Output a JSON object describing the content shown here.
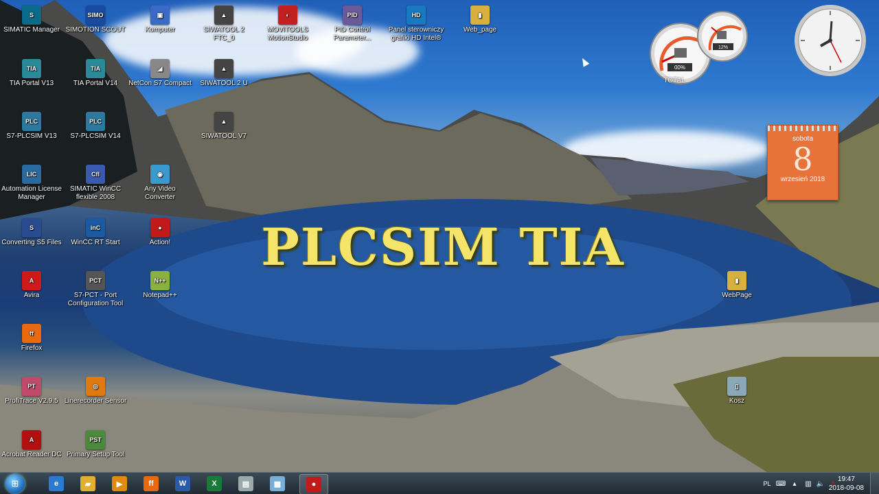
{
  "headline": "PLCSIM TIA",
  "desktop_icons": [
    {
      "label": "SIMATIC Manager",
      "glyph": "S",
      "color": "#0a6a8a"
    },
    {
      "label": "SIMOTION SCOUT",
      "glyph": "SIMO",
      "color": "#1a4aa0"
    },
    {
      "label": "Komputer",
      "glyph": "▣",
      "color": "#3a6ac8"
    },
    {
      "label": "SIWATOOL 2 FTC_0",
      "glyph": "▲",
      "color": "#444"
    },
    {
      "label": "MOVITOOLS MotionStudio",
      "glyph": "◐",
      "color": "#c02020"
    },
    {
      "label": "PID Control Parameter...",
      "glyph": "PID",
      "color": "#6a5a9a"
    },
    {
      "label": "Panel sterowniczy grafiki HD Intel®",
      "glyph": "HD",
      "color": "#1a7ac0"
    },
    {
      "label": "Web_page",
      "glyph": "▮",
      "color": "#d8b040"
    },
    {
      "label": "TIA Portal V13",
      "glyph": "TIA",
      "color": "#2a8a9a"
    },
    {
      "label": "TIA Portal V14",
      "glyph": "TIA",
      "color": "#2a8a9a"
    },
    {
      "label": "NetCon S7 Compact",
      "glyph": "◢",
      "color": "#888"
    },
    {
      "label": "SIWATOOL 2 U",
      "glyph": "▲",
      "color": "#444"
    },
    {
      "label": "S7-PLCSIM V13",
      "glyph": "PLC",
      "color": "#2a7aa0"
    },
    {
      "label": "S7-PLCSIM V14",
      "glyph": "PLC",
      "color": "#2a7aa0"
    },
    {
      "label": "SIWATOOL V7",
      "glyph": "▲",
      "color": "#444"
    },
    {
      "label": "Automation License Manager",
      "glyph": "LIC",
      "color": "#2a6aa0"
    },
    {
      "label": "SIMATIC WinCC flexible 2008",
      "glyph": "Cfl",
      "color": "#3a5ab0"
    },
    {
      "label": "Any Video Converter",
      "glyph": "◉",
      "color": "#3a9ad0"
    },
    {
      "label": "Converting S5 Files",
      "glyph": "S",
      "color": "#2a4a90"
    },
    {
      "label": "WinCC RT Start",
      "glyph": "inC",
      "color": "#1a5aa0"
    },
    {
      "label": "Action!",
      "glyph": "●",
      "color": "#c01a1a"
    },
    {
      "label": "Avira",
      "glyph": "A",
      "color": "#d01a1a"
    },
    {
      "label": "S7-PCT - Port Configuration Tool",
      "glyph": "PCT",
      "color": "#555"
    },
    {
      "label": "Notepad++",
      "glyph": "N++",
      "color": "#8ab040"
    },
    {
      "label": "WebPage",
      "glyph": "▮",
      "color": "#d8b040"
    },
    {
      "label": "Firefox",
      "glyph": "ff",
      "color": "#e86a10"
    },
    {
      "label": "Kosz",
      "glyph": "▯",
      "color": "#8aa8b8"
    },
    {
      "label": "ProfiTrace V2.9.5",
      "glyph": "PT",
      "color": "#c04a6a"
    },
    {
      "label": "Linerecorder Sensor",
      "glyph": "◎",
      "color": "#e07a10"
    },
    {
      "label": "Acrobat Reader DC",
      "glyph": "A",
      "color": "#b01010"
    },
    {
      "label": "Primary Setup Tool",
      "glyph": "PST",
      "color": "#4a8a3a"
    }
  ],
  "gadgets": {
    "gauge_cpu": "00%",
    "gauge_mem": "12%",
    "gauge_label": "TOTAL",
    "calendar_day_name": "sobota",
    "calendar_day": "8",
    "calendar_month": "wrzesień 2018"
  },
  "taskbar": {
    "buttons": [
      {
        "name": "ie-button",
        "glyph": "e",
        "color": "#2a7ad0"
      },
      {
        "name": "explorer-button",
        "glyph": "▰",
        "color": "#e0b030"
      },
      {
        "name": "media-button",
        "glyph": "▶",
        "color": "#e08a10"
      },
      {
        "name": "firefox-button",
        "glyph": "ff",
        "color": "#e86a10"
      },
      {
        "name": "word-button",
        "glyph": "W",
        "color": "#2a5aa8"
      },
      {
        "name": "excel-button",
        "glyph": "X",
        "color": "#1a7a3a"
      },
      {
        "name": "files-button",
        "glyph": "▤",
        "color": "#9aa"
      },
      {
        "name": "calculator-button",
        "glyph": "▦",
        "color": "#7ab0d8"
      },
      {
        "name": "action-button",
        "glyph": "●",
        "color": "#c01a1a"
      }
    ],
    "tray_lang": "PL",
    "time": "19:47",
    "date": "2018-09-08"
  },
  "colors": {
    "headline": "#f4e56a",
    "taskbar": "#1f2a32",
    "calendar": "#e8733a"
  }
}
